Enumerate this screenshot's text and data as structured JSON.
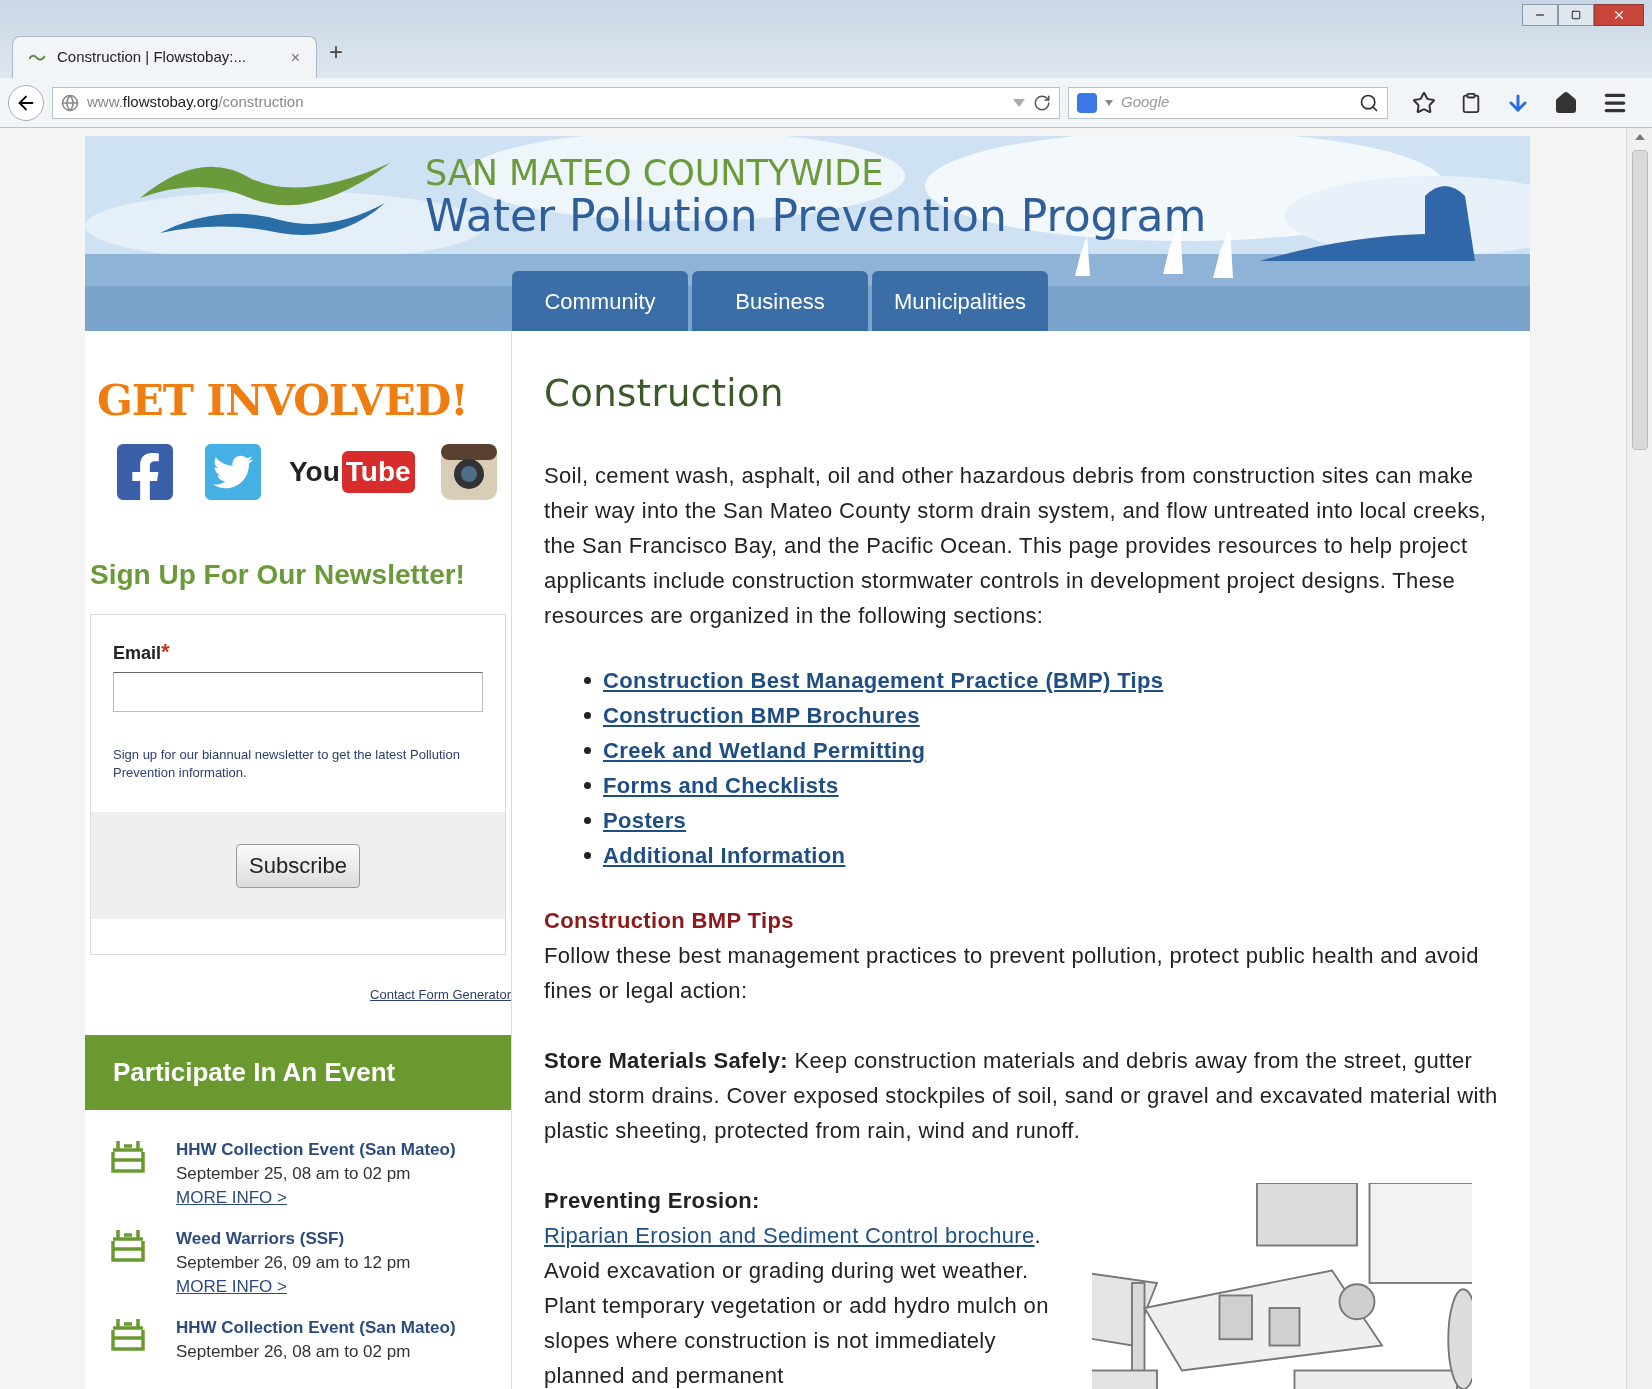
{
  "browser": {
    "tab": {
      "title": "Construction | Flowstobay:...",
      "close": "×",
      "selected": true
    },
    "new_tab": "+",
    "url": "www.**flowstobay.org**/construction",
    "search": {
      "placeholder": "Google"
    }
  },
  "header": {
    "org_line": "SAN MATEO COUNTYWIDE",
    "program": "Water Pollution Prevention Program"
  },
  "nav": [
    {
      "label": "Community",
      "selected": false
    },
    {
      "label": "Business",
      "selected": false
    },
    {
      "label": "Municipalities",
      "selected": false
    }
  ],
  "sidebar": {
    "get_involved": "GET INVOLVED!",
    "youtube": {
      "you": "You",
      "tube": "Tube"
    },
    "newsletter": {
      "heading": "Sign Up For Our Newsletter!",
      "email_label": "Email",
      "required_mark": "*",
      "help": "Sign up for our biannual newsletter to get the latest Pollution Prevention information.",
      "button": "Subscribe",
      "generator_link": "Contact Form Generator"
    },
    "events_heading": "Participate In An Event",
    "events": [
      {
        "title": "HHW Collection Event (San Mateo)",
        "when": "September 25, 08 am to 02 pm",
        "more": "MORE INFO >"
      },
      {
        "title": "Weed Warriors (SSF)",
        "when": "September 26, 09 am to 12 pm",
        "more": "MORE INFO >"
      },
      {
        "title": "HHW Collection Event (San Mateo)",
        "when": "September 26, 08 am to 02 pm"
      }
    ]
  },
  "content": {
    "title": "Construction",
    "intro": "Soil, cement wash, asphalt, oil and other hazardous debris from construction sites can make their way into the San Mateo County storm drain system, and flow untreated into local creeks, the San Francisco Bay, and the Pacific Ocean. This page provides resources to help project applicants include construction stormwater controls in development project designs. These resources are organized in the following sections:",
    "sections": [
      "Construction Best Management Practice (BMP) Tips",
      "Construction BMP Brochures",
      "Creek and Wetland Permitting",
      "Forms and Checklists",
      "Posters",
      "Additional Information"
    ],
    "tips_heading": "Construction BMP Tips",
    "tips_intro": "Follow these best management practices to prevent pollution, protect public health and avoid fines or legal action:",
    "store": "**Store Materials Safely:** Keep construction materials and debris away from the street, gutter and storm drains. Cover exposed stockpiles of soil, sand or gravel and excavated material with plastic sheeting, protected from rain, wind and runoff.",
    "erosion": {
      "lead": "Preventing Erosion:",
      "link": "Riparian Erosion and Sediment Control brochure",
      "text": ". Avoid excavation or grading during wet weather. Plant temporary vegetation or add hydro mulch on slopes where construction is not immediately planned and permanent"
    }
  }
}
